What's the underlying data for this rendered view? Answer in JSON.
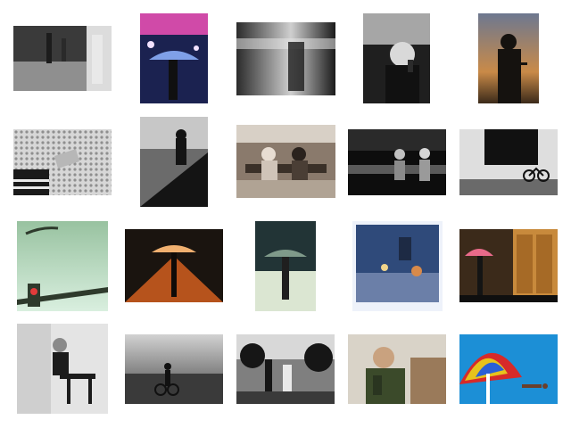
{
  "gallery": {
    "rows": [
      [
        {
          "name": "rainy-street-umbrella-legs",
          "palette": [
            "#2b2b2b",
            "#9a9a9a",
            "#e6e6e6"
          ]
        },
        {
          "name": "neon-night-umbrella",
          "palette": [
            "#1b2250",
            "#d04aa8",
            "#7fa0e8"
          ]
        },
        {
          "name": "motion-blur-walker",
          "palette": [
            "#161616",
            "#7a7a7a",
            "#dcdcdc"
          ]
        },
        {
          "name": "old-woman-phone",
          "palette": [
            "#202020",
            "#8d8d8d",
            "#e8e8e8"
          ]
        },
        {
          "name": "sunset-silhouette-phone",
          "palette": [
            "#15120f",
            "#c98a48",
            "#6d7890"
          ]
        }
      ],
      [
        {
          "name": "hand-on-textured-wall",
          "palette": [
            "#1a1a1a",
            "#8f8f8f",
            "#d7d7d7"
          ]
        },
        {
          "name": "man-sitting-bench",
          "palette": [
            "#141414",
            "#6b6b6b",
            "#c7c7c7"
          ]
        },
        {
          "name": "couple-on-bench-street",
          "palette": [
            "#3a3028",
            "#8a7a6c",
            "#d8d0c6"
          ]
        },
        {
          "name": "couple-bench-dark",
          "palette": [
            "#0d0d0d",
            "#5a5a5a",
            "#c0c0c0"
          ]
        },
        {
          "name": "storefront-bicycle",
          "palette": [
            "#111111",
            "#6a6a6a",
            "#dedede"
          ]
        }
      ],
      [
        {
          "name": "traffic-light-green-sky",
          "palette": [
            "#2e3a2c",
            "#98c2a0",
            "#d9efdf"
          ]
        },
        {
          "name": "night-street-umbrella-orange",
          "palette": [
            "#1a140f",
            "#c85a1e",
            "#f0b070"
          ]
        },
        {
          "name": "rain-umbrella-teal",
          "palette": [
            "#223436",
            "#7f9a8a",
            "#dbe6d2"
          ]
        },
        {
          "name": "blurred-street-bokeh",
          "palette": [
            "#2f4a7a",
            "#d88a4a",
            "#eef2fa"
          ]
        },
        {
          "name": "pink-umbrella-doorway",
          "palette": [
            "#3b2a1a",
            "#c88a3c",
            "#e86a8a"
          ]
        }
      ],
      [
        {
          "name": "woman-reading-bench",
          "palette": [
            "#1c1c1c",
            "#8a8a8a",
            "#e4e4e4"
          ]
        },
        {
          "name": "cyclist-cloudy-street",
          "palette": [
            "#1f1f1f",
            "#7c7c7c",
            "#d2d2d2"
          ]
        },
        {
          "name": "park-people-trees",
          "palette": [
            "#161616",
            "#7f7f7f",
            "#d8d8d8"
          ]
        },
        {
          "name": "man-green-jacket-phone",
          "palette": [
            "#3b4a2a",
            "#9a7a5a",
            "#d9d3c8"
          ]
        },
        {
          "name": "rainbow-umbrella-pool",
          "palette": [
            "#1c8fd6",
            "#e7c21c",
            "#d62a2a"
          ]
        }
      ]
    ]
  }
}
